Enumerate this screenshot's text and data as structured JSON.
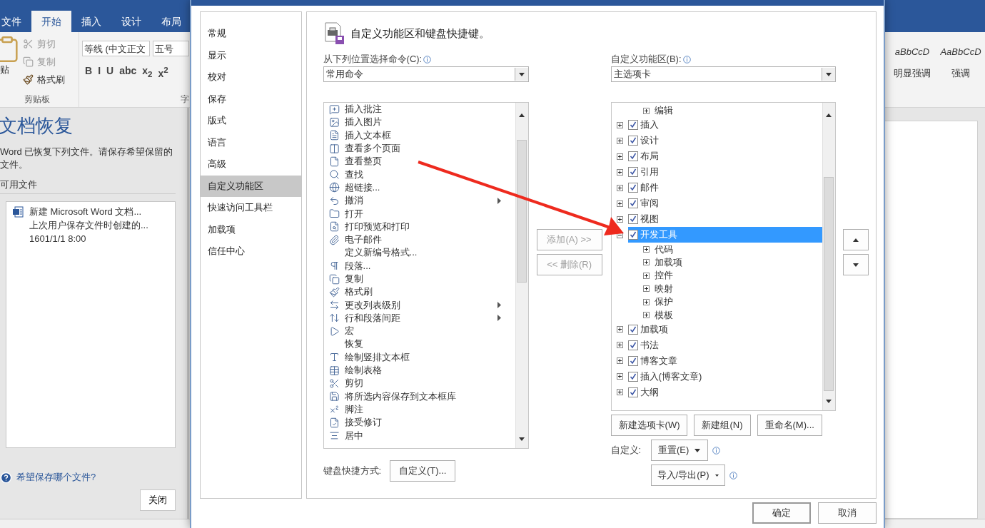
{
  "word": {
    "ribbon_tabs": [
      {
        "label": "文件",
        "selected": false
      },
      {
        "label": "开始",
        "selected": true
      },
      {
        "label": "插入",
        "selected": false
      },
      {
        "label": "设计",
        "selected": false
      },
      {
        "label": "布局",
        "selected": false
      }
    ],
    "clipboard": {
      "paste": "贴",
      "group": "剪贴板",
      "items": [
        {
          "label": "剪切",
          "disabled": true
        },
        {
          "label": "复制",
          "disabled": true
        },
        {
          "label": "格式刷",
          "disabled": false
        }
      ]
    },
    "font": {
      "name": "等线 (中文正文",
      "size": "五号",
      "group": "字",
      "format_buttons": [
        "B",
        "I",
        "U",
        "abc",
        "x$_{2}$",
        "x$^{2}$"
      ]
    },
    "styles": [
      {
        "preview": "aBbCcD",
        "label": "明显强调"
      },
      {
        "preview": "AaBbCcD",
        "label": "强调"
      }
    ],
    "recovery": {
      "title": "文档恢复",
      "description": "Word 已恢复下列文件。请保存希望保留的文件。",
      "files_label": "可用文件",
      "files": [
        {
          "name": "新建 Microsoft Word 文档...",
          "note": "上次用户保存文件时创建的...",
          "time": "1601/1/1 8:00"
        }
      ],
      "help_link": "希望保存哪个文件?",
      "close": "关闭"
    }
  },
  "dialog": {
    "nav": [
      {
        "label": "常规",
        "selected": false
      },
      {
        "label": "显示",
        "selected": false
      },
      {
        "label": "校对",
        "selected": false
      },
      {
        "label": "保存",
        "selected": false
      },
      {
        "label": "版式",
        "selected": false
      },
      {
        "label": "语言",
        "selected": false
      },
      {
        "label": "高级",
        "selected": false
      },
      {
        "label": "自定义功能区",
        "selected": true
      },
      {
        "label": "快速访问工具栏",
        "selected": false
      },
      {
        "label": "加载项",
        "selected": false
      },
      {
        "label": "信任中心",
        "selected": false
      }
    ],
    "heading": "自定义功能区和键盘快捷键。",
    "commands_label": "从下列位置选择命令(C):",
    "commands_source": "常用命令",
    "commands": [
      {
        "label": "插入批注",
        "submenu": false
      },
      {
        "label": "插入图片",
        "submenu": false
      },
      {
        "label": "插入文本框",
        "submenu": false
      },
      {
        "label": "查看多个页面",
        "submenu": false
      },
      {
        "label": "查看整页",
        "submenu": false
      },
      {
        "label": "查找",
        "submenu": false
      },
      {
        "label": "超链接...",
        "submenu": false
      },
      {
        "label": "撤消",
        "submenu": true
      },
      {
        "label": "打开",
        "submenu": false
      },
      {
        "label": "打印预览和打印",
        "submenu": false
      },
      {
        "label": "电子邮件",
        "submenu": false
      },
      {
        "label": "定义新编号格式...",
        "submenu": false
      },
      {
        "label": "段落...",
        "submenu": false
      },
      {
        "label": "复制",
        "submenu": false
      },
      {
        "label": "格式刷",
        "submenu": false
      },
      {
        "label": "更改列表级别",
        "submenu": true
      },
      {
        "label": "行和段落间距",
        "submenu": true
      },
      {
        "label": "宏",
        "submenu": false
      },
      {
        "label": "恢复",
        "submenu": false
      },
      {
        "label": "绘制竖排文本框",
        "submenu": false
      },
      {
        "label": "绘制表格",
        "submenu": false
      },
      {
        "label": "剪切",
        "submenu": false
      },
      {
        "label": "将所选内容保存到文本框库",
        "submenu": false
      },
      {
        "label": "脚注",
        "submenu": false
      },
      {
        "label": "接受修订",
        "submenu": false
      },
      {
        "label": "居中",
        "submenu": false
      }
    ],
    "add_button": {
      "label": "添加(A) >>",
      "disabled": true
    },
    "remove_button": {
      "label": "<< 删除(R)",
      "disabled": true
    },
    "ribbon_label": "自定义功能区(B):",
    "ribbon_source": "主选项卡",
    "tree": [
      {
        "kind": "group",
        "label": "编辑",
        "expanded": false
      },
      {
        "kind": "tab",
        "label": "插入",
        "checked": true,
        "expanded": false,
        "selected": false
      },
      {
        "kind": "tab",
        "label": "设计",
        "checked": true,
        "expanded": false,
        "selected": false
      },
      {
        "kind": "tab",
        "label": "布局",
        "checked": true,
        "expanded": false,
        "selected": false
      },
      {
        "kind": "tab",
        "label": "引用",
        "checked": true,
        "expanded": false,
        "selected": false
      },
      {
        "kind": "tab",
        "label": "邮件",
        "checked": true,
        "expanded": false,
        "selected": false
      },
      {
        "kind": "tab",
        "label": "审阅",
        "checked": true,
        "expanded": false,
        "selected": false
      },
      {
        "kind": "tab",
        "label": "视图",
        "checked": true,
        "expanded": false,
        "selected": false
      },
      {
        "kind": "tab",
        "label": "开发工具",
        "checked": true,
        "expanded": true,
        "selected": true,
        "children": [
          {
            "kind": "group",
            "label": "代码",
            "expanded": false
          },
          {
            "kind": "group",
            "label": "加载项",
            "expanded": false
          },
          {
            "kind": "group",
            "label": "控件",
            "expanded": false
          },
          {
            "kind": "group",
            "label": "映射",
            "expanded": false
          },
          {
            "kind": "group",
            "label": "保护",
            "expanded": false
          },
          {
            "kind": "group",
            "label": "模板",
            "expanded": false
          }
        ]
      },
      {
        "kind": "tab",
        "label": "加载项",
        "checked": true,
        "expanded": false,
        "selected": false
      },
      {
        "kind": "tab",
        "label": "书法",
        "checked": true,
        "expanded": false,
        "selected": false
      },
      {
        "kind": "tab",
        "label": "博客文章",
        "checked": true,
        "expanded": false,
        "selected": false
      },
      {
        "kind": "tab",
        "label": "插入(博客文章)",
        "checked": true,
        "expanded": false,
        "selected": false
      },
      {
        "kind": "tab",
        "label": "大纲",
        "checked": true,
        "expanded": false,
        "selected": false
      }
    ],
    "tree_buttons": [
      "新建选项卡(W)",
      "新建组(N)",
      "重命名(M)..."
    ],
    "customize_label": "自定义:",
    "reset_button": "重置(E)",
    "import_export_button": "导入/导出(P)",
    "shortcuts_label": "键盘快捷方式:",
    "shortcuts_button": "自定义(T)...",
    "ok": "确定",
    "cancel": "取消"
  }
}
